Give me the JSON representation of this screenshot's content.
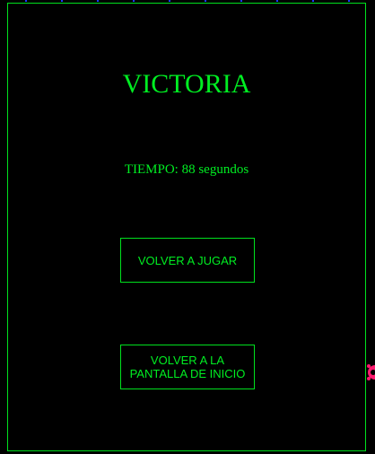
{
  "screen": {
    "title": "VICTORIA",
    "time_label": "TIEMPO:",
    "time_value": "88",
    "time_unit": "segundos"
  },
  "buttons": {
    "replay_label": "VOLVER A JUGAR",
    "home_label": "VOLVER A LA PANTALLA DE INICIO"
  },
  "colors": {
    "background": "#000000",
    "accent": "#00ee22",
    "border": "#00e01e",
    "marker": "#ff1a6e"
  }
}
